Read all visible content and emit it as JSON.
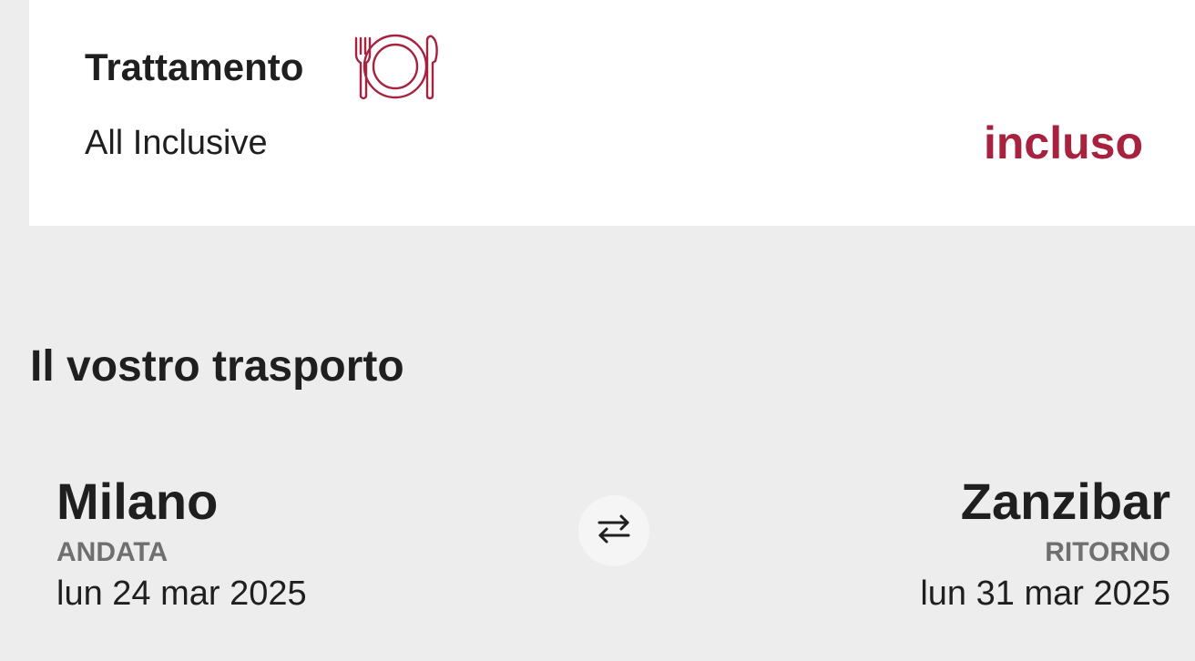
{
  "board": {
    "title": "Trattamento",
    "icon": "plate-cutlery-icon",
    "value": "All Inclusive",
    "status": "incluso"
  },
  "transport": {
    "section_title": "Il vostro trasporto",
    "outbound": {
      "city": "Milano",
      "label": "ANDATA",
      "date": "lun 24 mar 2025"
    },
    "inbound": {
      "city": "Zanzibar",
      "label": "RITORNO",
      "date": "lun 31 mar 2025"
    },
    "swap_icon": "swap-arrows-icon"
  },
  "colors": {
    "accent": "#a7223f",
    "background": "#ededed",
    "card": "#ffffff",
    "muted": "#6f6f6f",
    "text": "#1f1f1f"
  }
}
